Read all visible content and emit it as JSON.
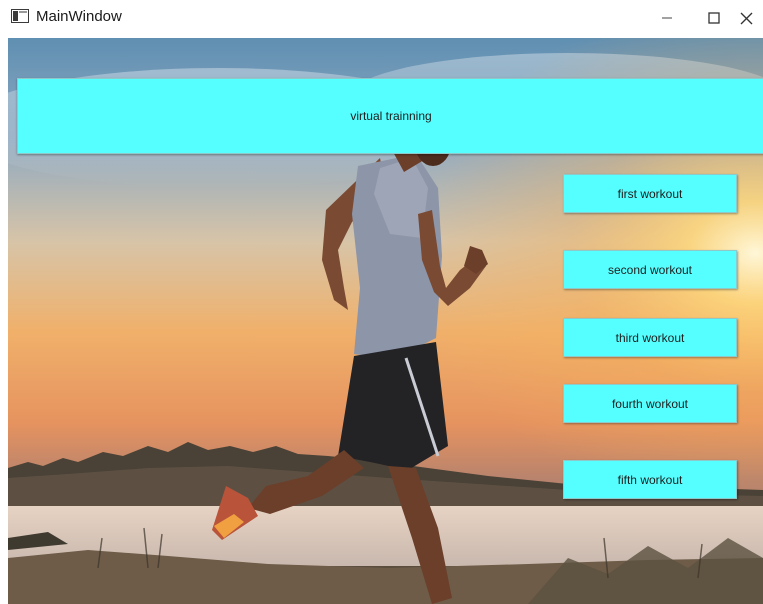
{
  "window": {
    "title": "MainWindow",
    "controls": [
      "minimize-icon",
      "maximize-icon",
      "close-icon"
    ]
  },
  "header": {
    "label": "virtual trainning"
  },
  "workouts": [
    {
      "label": "first workout"
    },
    {
      "label": "second workout"
    },
    {
      "label": "third workout"
    },
    {
      "label": "fourth workout"
    },
    {
      "label": "fifth workout"
    }
  ],
  "colors": {
    "button_fill": "#55ffff",
    "sky_top": "#5f8fb2",
    "sunset_glow": "#ffd77a",
    "lake": "#e7d3c3"
  },
  "background_image": "runner-at-sunset-photo"
}
